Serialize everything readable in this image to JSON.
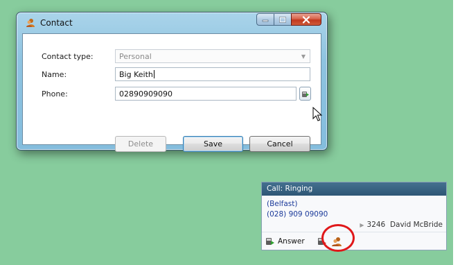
{
  "window": {
    "title": "Contact",
    "fields": {
      "contact_type_label": "Contact type:",
      "contact_type_value": "Personal",
      "name_label": "Name:",
      "name_value": "Big Keith",
      "phone_label": "Phone:",
      "phone_value": "02890909090"
    },
    "buttons": {
      "delete": "Delete",
      "save": "Save",
      "cancel": "Cancel"
    }
  },
  "call_popup": {
    "header": "Call: Ringing",
    "location": "(Belfast)",
    "number": "(028) 909 09090",
    "extension": "3246",
    "agent": "David McBride",
    "answer_label": "Answer"
  },
  "colors": {
    "desktop": "#87cc9d",
    "popup_header": "#2e5675",
    "highlight_circle": "#e0181a"
  }
}
